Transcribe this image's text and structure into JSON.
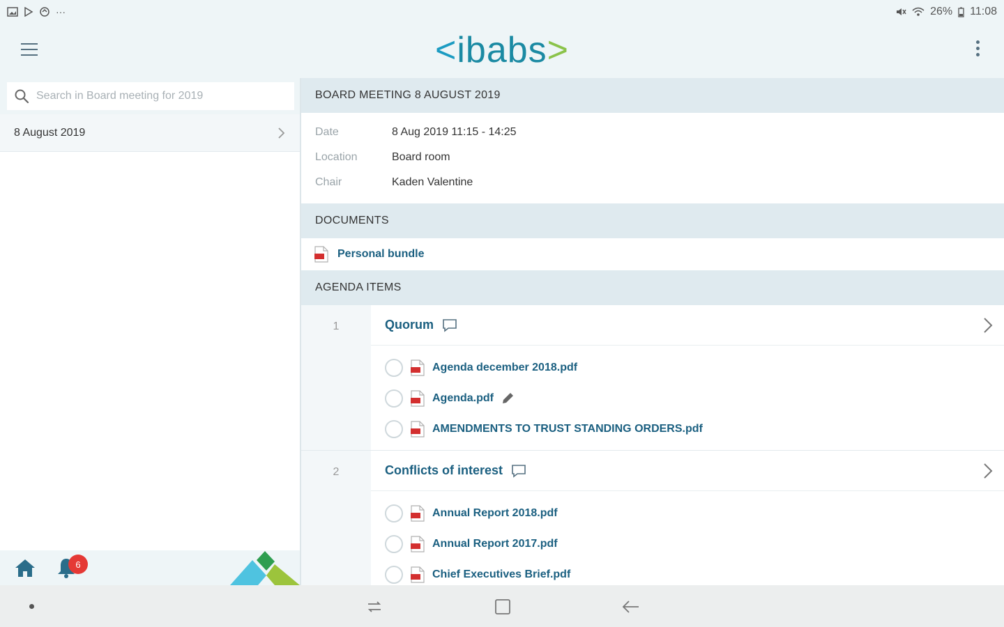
{
  "status_bar": {
    "battery": "26%",
    "time": "11:08",
    "left_icons": [
      "gallery-icon",
      "play-store-icon",
      "sync-icon",
      "more-notifications-icon"
    ]
  },
  "app_bar": {
    "logo_left": "<",
    "logo_text": "ibabs",
    "logo_right": ">"
  },
  "sidebar": {
    "search_placeholder": "Search in Board meeting for 2019",
    "items": [
      {
        "label": "8 August 2019"
      }
    ],
    "notification_count": "6"
  },
  "meeting": {
    "header": "BOARD MEETING 8 AUGUST 2019",
    "details": [
      {
        "label": "Date",
        "value": "8 Aug 2019 11:15 - 14:25"
      },
      {
        "label": "Location",
        "value": "Board room"
      },
      {
        "label": "Chair",
        "value": "Kaden Valentine"
      }
    ]
  },
  "documents": {
    "header": "DOCUMENTS",
    "items": [
      {
        "name": "Personal bundle"
      }
    ]
  },
  "agenda": {
    "header": "AGENDA ITEMS",
    "items": [
      {
        "number": "1",
        "title": "Quorum",
        "files": [
          {
            "name": "Agenda december 2018.pdf"
          },
          {
            "name": "Agenda.pdf"
          },
          {
            "name": "AMENDMENTS TO TRUST STANDING ORDERS.pdf"
          }
        ]
      },
      {
        "number": "2",
        "title": "Conflicts of interest",
        "files": [
          {
            "name": "Annual Report 2018.pdf"
          },
          {
            "name": "Annual Report 2017.pdf"
          },
          {
            "name": "Chief Executives Brief.pdf"
          }
        ]
      }
    ]
  },
  "colors": {
    "accent": "#1a5f80",
    "header_bg": "#dfeaef",
    "app_bar_bg": "#eef5f7",
    "logo_blue": "#1b8aa3",
    "logo_green": "#8bc34a",
    "badge_red": "#e53935",
    "pdf_red": "#d32f2f"
  }
}
